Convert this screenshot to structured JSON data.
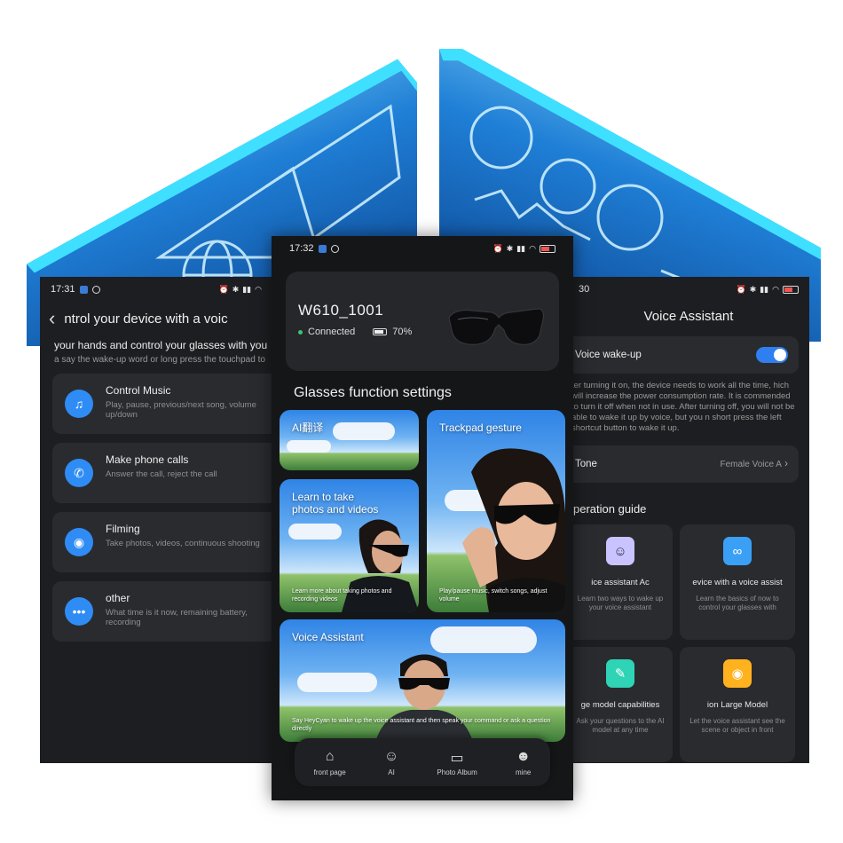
{
  "left_phone": {
    "status": {
      "time": "17:31"
    },
    "header": {
      "title": "ntrol your device with a voic"
    },
    "intro": "your hands and control your glasses with you",
    "intro_hint": "a say the wake-up word or long press the touchpad to",
    "items": [
      {
        "title": "Control Music",
        "desc": "Play, pause, previous/next song, volume up/down",
        "icon": "music-icon"
      },
      {
        "title": "Make phone calls",
        "desc": "Answer the call, reject the call",
        "icon": "phone-icon"
      },
      {
        "title": "Filming",
        "desc": "Take photos, videos, continuous shooting",
        "icon": "camera-icon"
      },
      {
        "title": "other",
        "desc": "What time is it now, remaining battery, recording",
        "icon": "more-icon"
      }
    ]
  },
  "center_phone": {
    "status": {
      "time": "17:32"
    },
    "device": {
      "name": "W610_1001",
      "connection": "Connected",
      "battery": "70%"
    },
    "section_title": "Glasses function settings",
    "tiles": {
      "ai_translate": {
        "label": "AI翻译"
      },
      "trackpad": {
        "label": "Trackpad gesture",
        "sub": "Play/pause music, switch songs, adjust volume"
      },
      "learn": {
        "label": "Learn to take photos and videos",
        "sub": "Learn more about taking photos and recording videos"
      },
      "voice": {
        "label": "Voice Assistant",
        "sub": "Say HeyCyan to wake up the voice assistant and then speak your command or ask a question directly"
      }
    },
    "tabs": [
      {
        "label": "front page",
        "icon": "home-icon"
      },
      {
        "label": "AI",
        "icon": "robot-icon"
      },
      {
        "label": "Photo Album",
        "icon": "image-icon"
      },
      {
        "label": "mine",
        "icon": "user-icon"
      }
    ]
  },
  "right_phone": {
    "status": {
      "time": "30"
    },
    "title": "Voice Assistant",
    "wakeup": {
      "label": "Voice wake-up",
      "enabled": true
    },
    "note": "ter turning it on, the device needs to work all the time, hich will increase the power consumption rate. It is commended to turn it off when not in use. After turning off, you will not be able to wake it up by voice, but you n short press the left shortcut button to wake it up.",
    "tone": {
      "label": "Tone",
      "value": "Female Voice A"
    },
    "guide_title": "peration guide",
    "guide": [
      {
        "title": "ice assistant     Ac",
        "desc": "Learn two ways to wake up your voice assistant",
        "icon": "robot-icon",
        "color": "#c9c3ff"
      },
      {
        "title": "evice with a voice assist",
        "desc": "Learn the basics of now to control your glasses with",
        "icon": "glasses-icon",
        "color": "#3aa0f5"
      },
      {
        "title": "ge model capabilities",
        "desc": "Ask your questions to the AI model at any time",
        "icon": "note-icon",
        "color": "#2fd3b5"
      },
      {
        "title": "ion Large Model",
        "desc": "Let the voice assistant see the scene or object in front",
        "icon": "eye-icon",
        "color": "#ffb21e"
      }
    ]
  },
  "colors": {
    "accent": "#2f8cf5",
    "panel": "#2a2b2f",
    "background": "#1d1e21",
    "holo": "#29b6ff"
  }
}
